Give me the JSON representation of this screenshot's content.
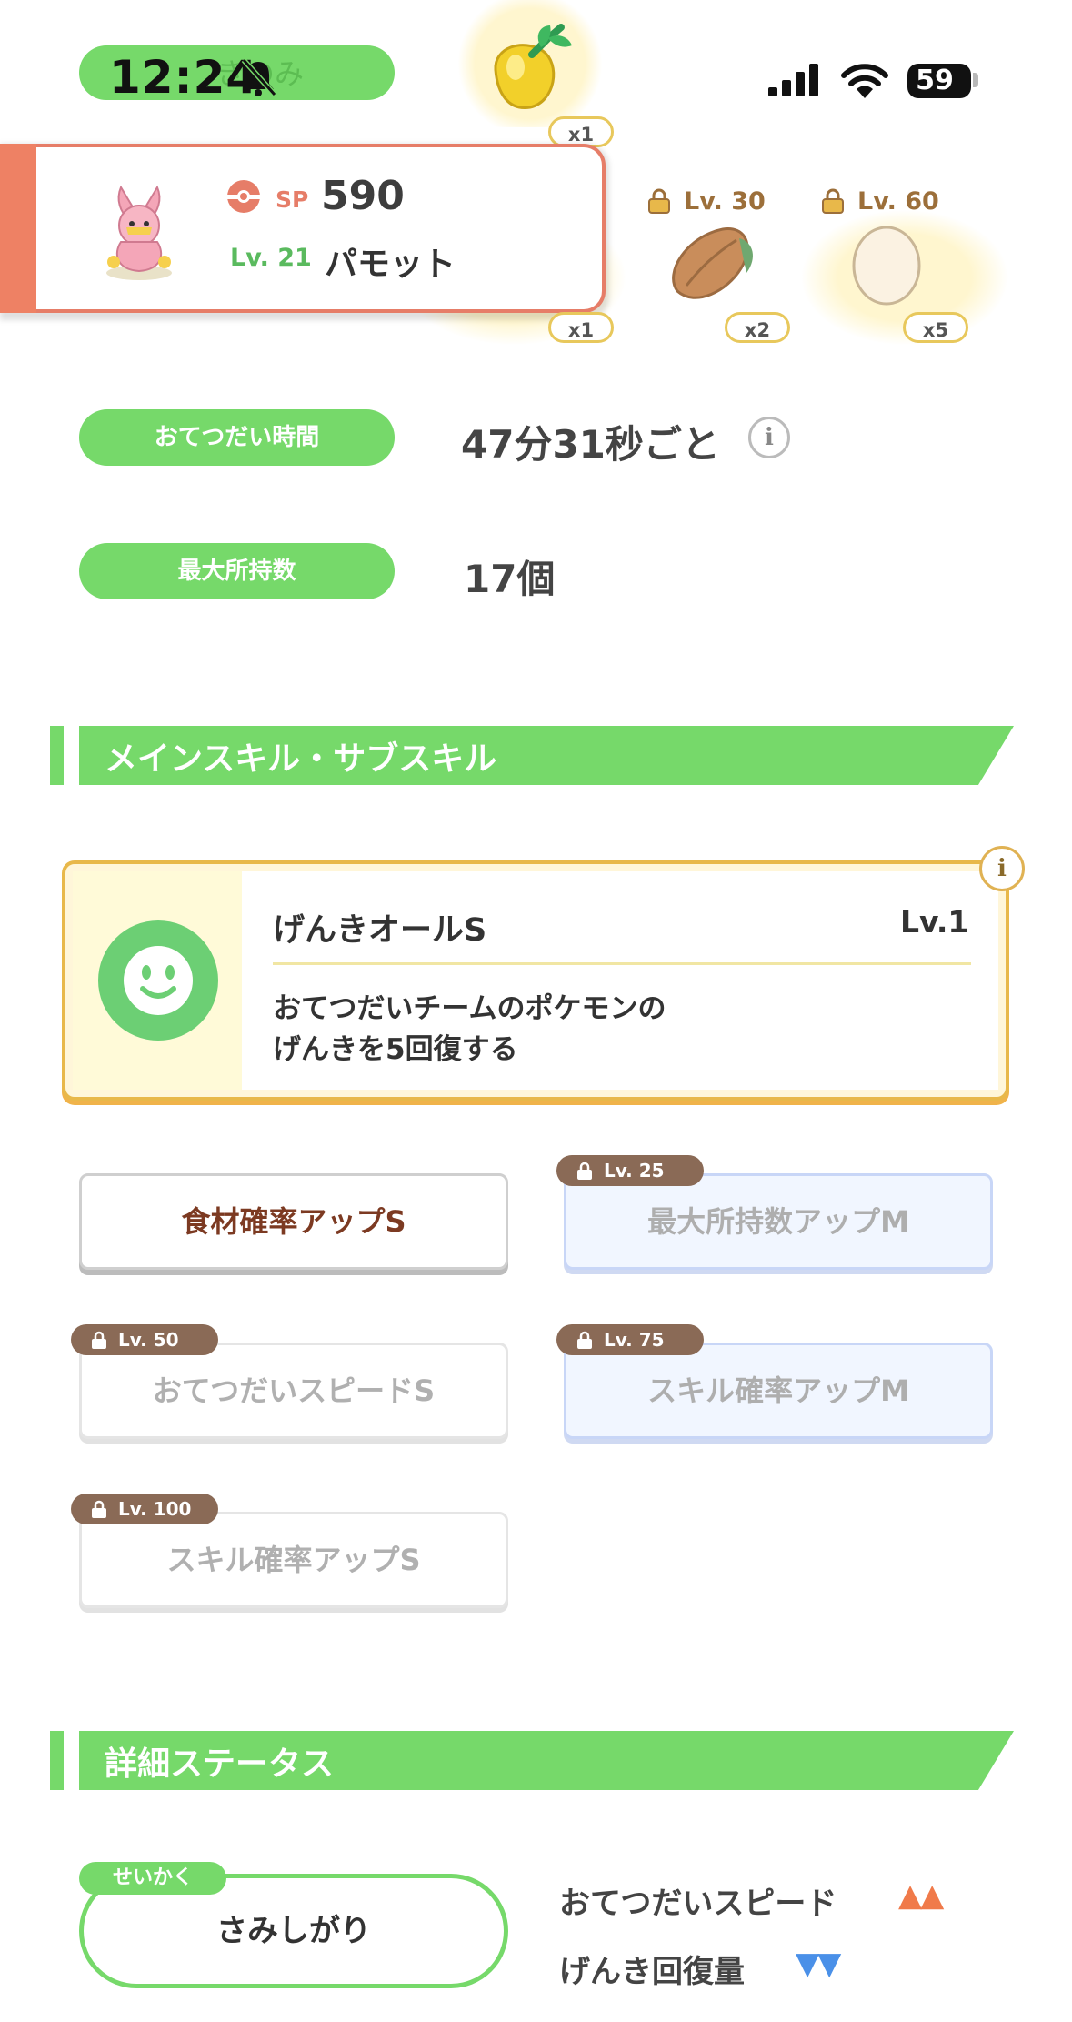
{
  "status_bar": {
    "time": "12:24",
    "battery": "59",
    "partial_text": "きのみ"
  },
  "ingredients": {
    "slot1": {
      "qty": "x1",
      "qty_under_card": "x1"
    },
    "slot2": {
      "lock_level": "Lv. 30",
      "qty": "x2"
    },
    "slot3": {
      "lock_level": "Lv. 60",
      "qty": "x5"
    }
  },
  "pokemon": {
    "sp_label": "SP",
    "sp_value": "590",
    "level": "Lv. 21",
    "name": "パモット"
  },
  "info_rows": {
    "help_time": {
      "label": "おてつだい時間",
      "value": "47分31秒ごと"
    },
    "max_carry": {
      "label": "最大所持数",
      "value": "17個"
    }
  },
  "skills_section": {
    "title": "メインスキル・サブスキル",
    "main_skill": {
      "name": "げんきオールS",
      "level": "Lv.1",
      "description_line1": "おてつだいチームのポケモンの",
      "description_line2": "げんきを5回復する"
    },
    "sub_skills": [
      {
        "label": "食材確率アップS",
        "lock": ""
      },
      {
        "label": "最大所持数アップM",
        "lock": "Lv. 25"
      },
      {
        "label": "おてつだいスピードS",
        "lock": "Lv. 50"
      },
      {
        "label": "スキル確率アップM",
        "lock": "Lv. 75"
      },
      {
        "label": "スキル確率アップS",
        "lock": "Lv. 100"
      }
    ]
  },
  "status_section": {
    "title": "詳細ステータス",
    "nature_tag": "せいかく",
    "nature": "さみしがり",
    "up_stat": "おてつだいスピード",
    "up_marks": "▲▲",
    "down_stat": "げんき回復量",
    "down_marks": "▼▼"
  },
  "colors": {
    "green": "#76d96a",
    "salmon": "#e67d68",
    "gold": "#e8b84a",
    "up": "#f07a4a",
    "down": "#4a90e8"
  }
}
